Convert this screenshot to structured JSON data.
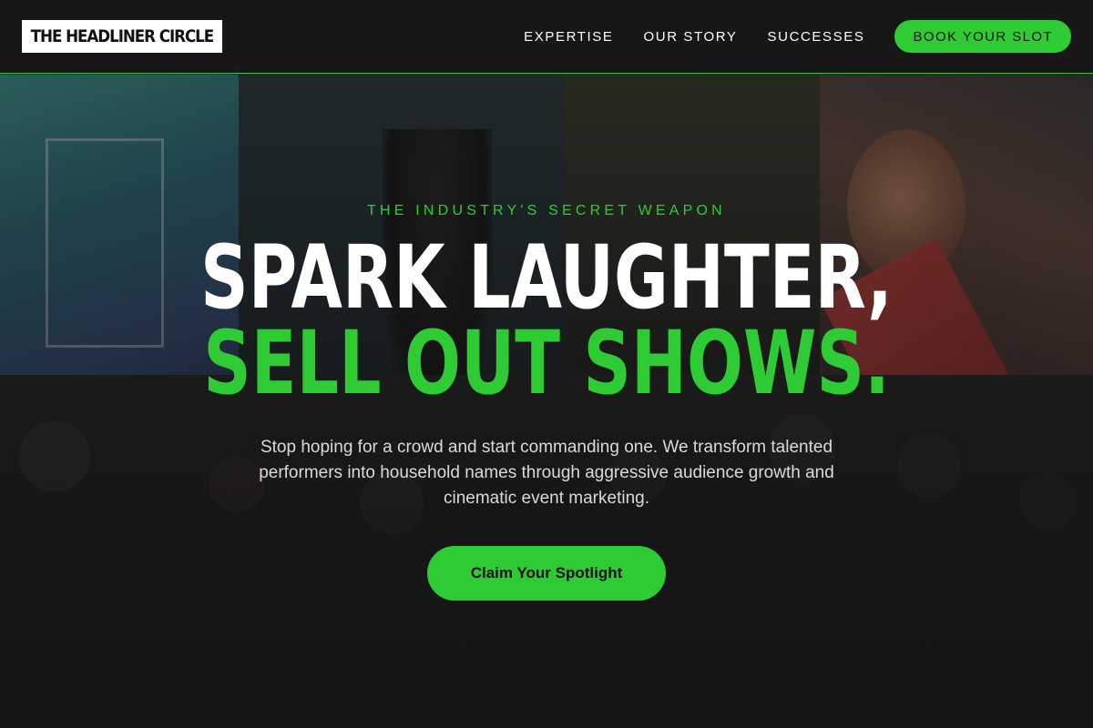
{
  "header": {
    "logo": "THE HEADLINER CIRCLE",
    "nav": [
      {
        "label": "EXPERTISE"
      },
      {
        "label": "OUR STORY"
      },
      {
        "label": "SUCCESSES"
      }
    ],
    "cta_label": "BOOK YOUR SLOT"
  },
  "hero": {
    "eyebrow": "THE INDUSTRY'S SECRET WEAPON",
    "headline_line1": "SPARK LAUGHTER,",
    "headline_line2": "SELL OUT SHOWS.",
    "subtext": "Stop hoping for a crowd and start commanding one. We transform talented performers into household names through aggressive audience growth and cinematic event marketing.",
    "cta_label": "Claim Your Spotlight",
    "background_image": "speaker-on-stage-with-crowd"
  },
  "colors": {
    "accent": "#2fcb34",
    "header_bg": "#171717",
    "page_bg": "#151515",
    "text": "#ffffff"
  }
}
